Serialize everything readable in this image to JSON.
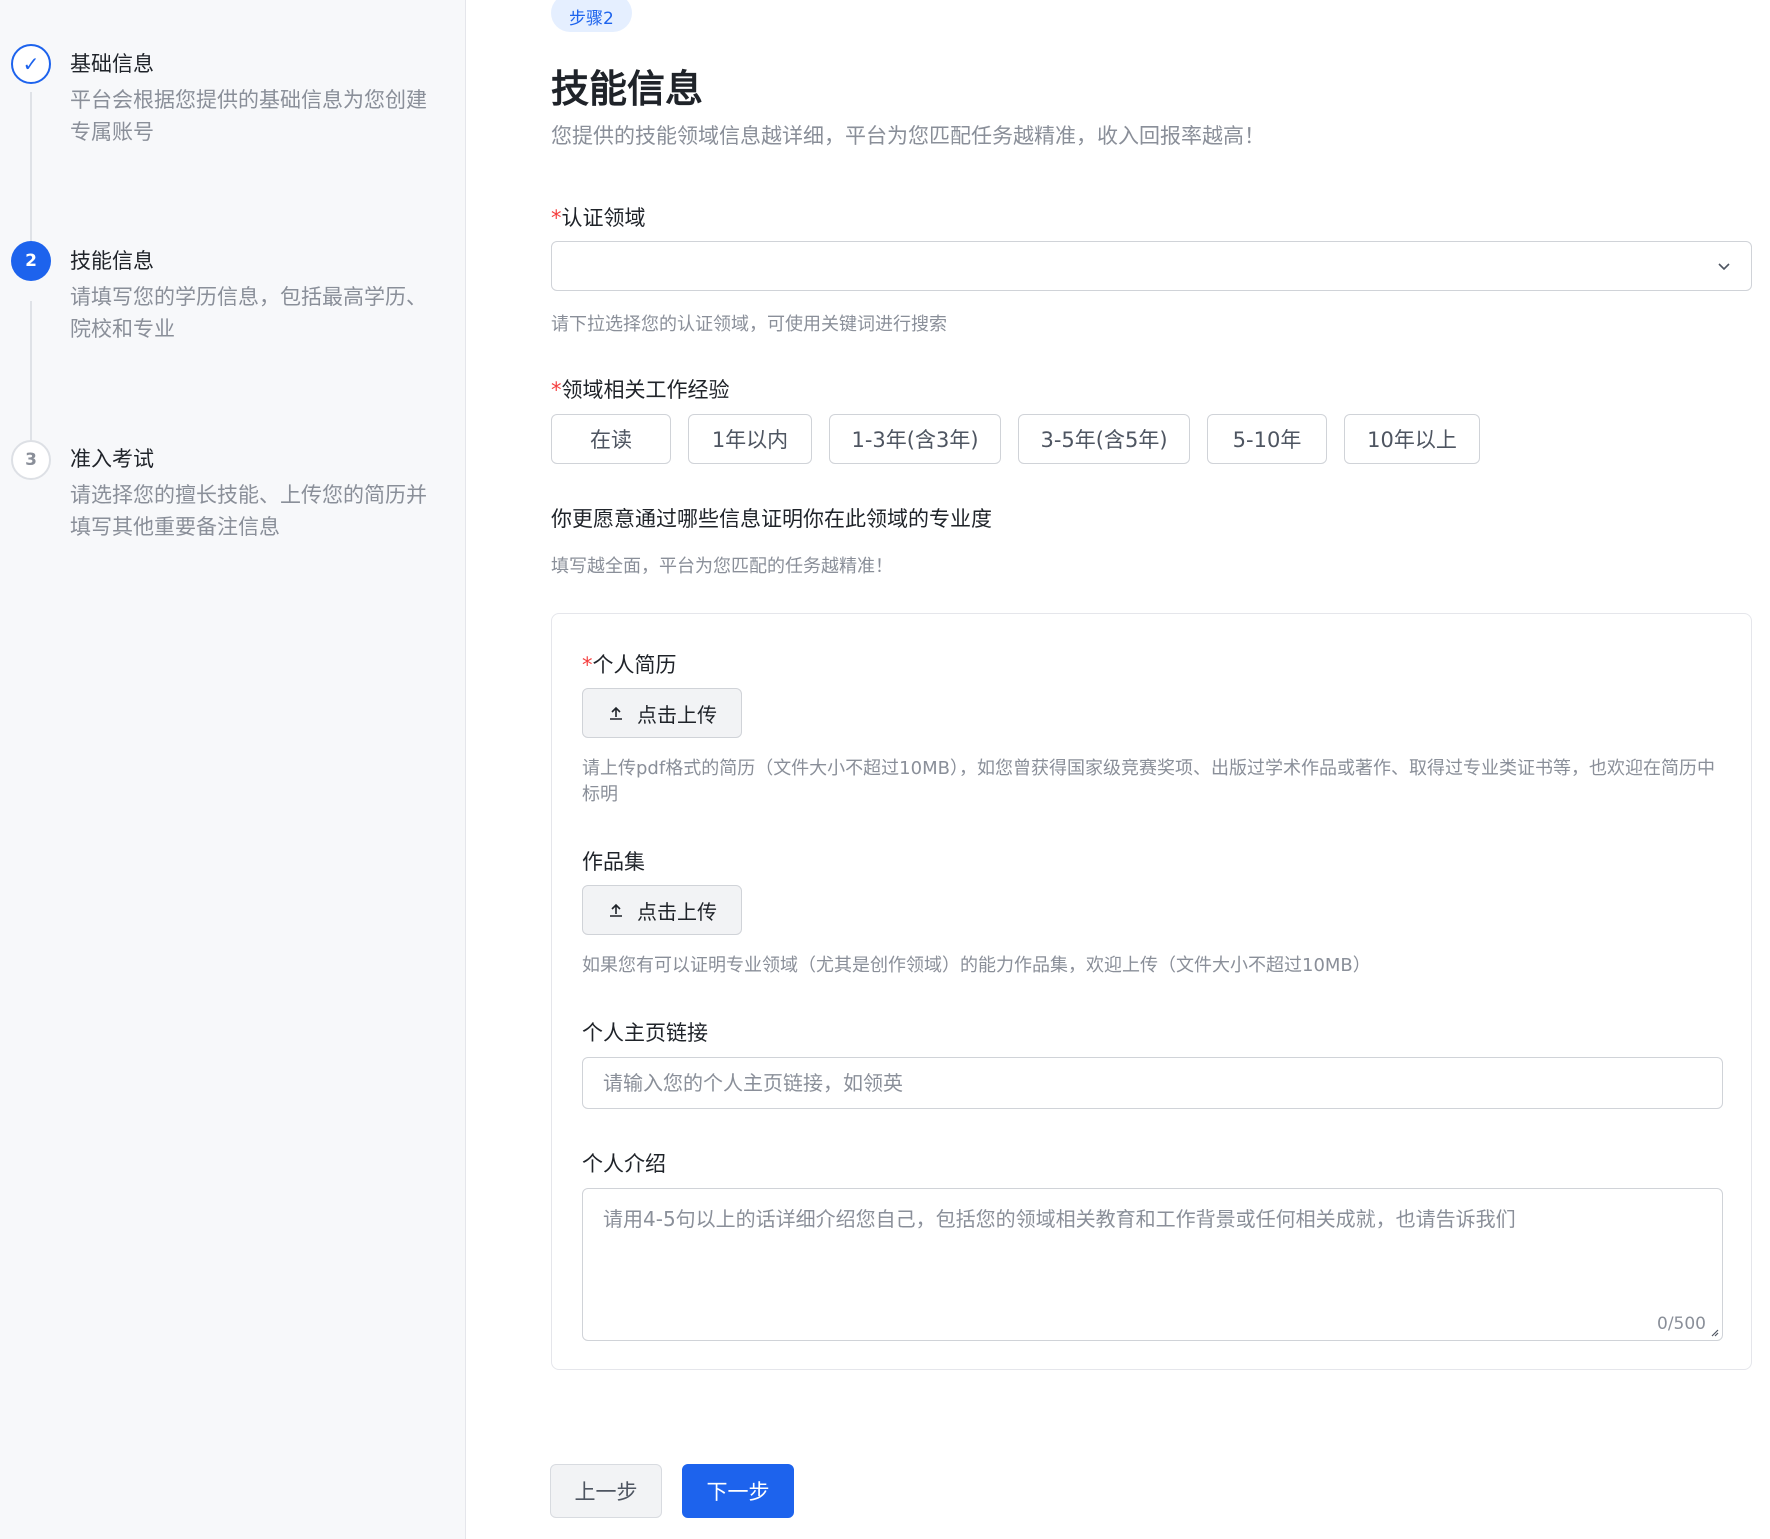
{
  "sidebar": {
    "steps": [
      {
        "number": "✓",
        "title": "基础信息",
        "desc": "平台会根据您提供的基础信息为您创建专属账号",
        "state": "done"
      },
      {
        "number": "2",
        "title": "技能信息",
        "desc": "请填写您的学历信息，包括最高学历、院校和专业",
        "state": "active"
      },
      {
        "number": "3",
        "title": "准入考试",
        "desc": "请选择您的擅长技能、上传您的简历并填写其他重要备注信息",
        "state": "todo"
      }
    ]
  },
  "main": {
    "step_tag": "步骤2",
    "title": "技能信息",
    "subtitle": "您提供的技能领域信息越详细，平台为您匹配任务越精准，收入回报率越高！",
    "domain": {
      "required_mark": "*",
      "label": "认证领域",
      "hint": "请下拉选择您的认证领域，可使用关键词进行搜索"
    },
    "experience": {
      "required_mark": "*",
      "label": "领域相关工作经验",
      "options": [
        "在读",
        "1年以内",
        "1-3年(含3年)",
        "3-5年(含5年)",
        "5-10年",
        "10年以上"
      ]
    },
    "proof": {
      "heading": "你更愿意通过哪些信息证明你在此领域的专业度",
      "hint": "填写越全面，平台为您匹配的任务越精准！"
    },
    "resume": {
      "required_mark": "*",
      "label": "个人简历",
      "upload_label": "点击上传",
      "hint": "请上传pdf格式的简历（文件大小不超过10MB），如您曾获得国家级竞赛奖项、出版过学术作品或著作、取得过专业类证书等，也欢迎在简历中标明"
    },
    "portfolio": {
      "label": "作品集",
      "upload_label": "点击上传",
      "hint": "如果您有可以证明专业领域（尤其是创作领域）的能力作品集，欢迎上传（文件大小不超过10MB）"
    },
    "homepage": {
      "label": "个人主页链接",
      "placeholder": "请输入您的个人主页链接，如领英"
    },
    "intro": {
      "label": "个人介绍",
      "placeholder": "请用4-5句以上的话详细介绍您自己，包括您的领域相关教育和工作背景或任何相关成就，也请告诉我们",
      "counter": "0/500"
    },
    "buttons": {
      "prev": "上一步",
      "next": "下一步"
    }
  },
  "colors": {
    "accent": "#1d63ed",
    "required": "#f53f3f",
    "muted_text": "#8a8f99"
  }
}
